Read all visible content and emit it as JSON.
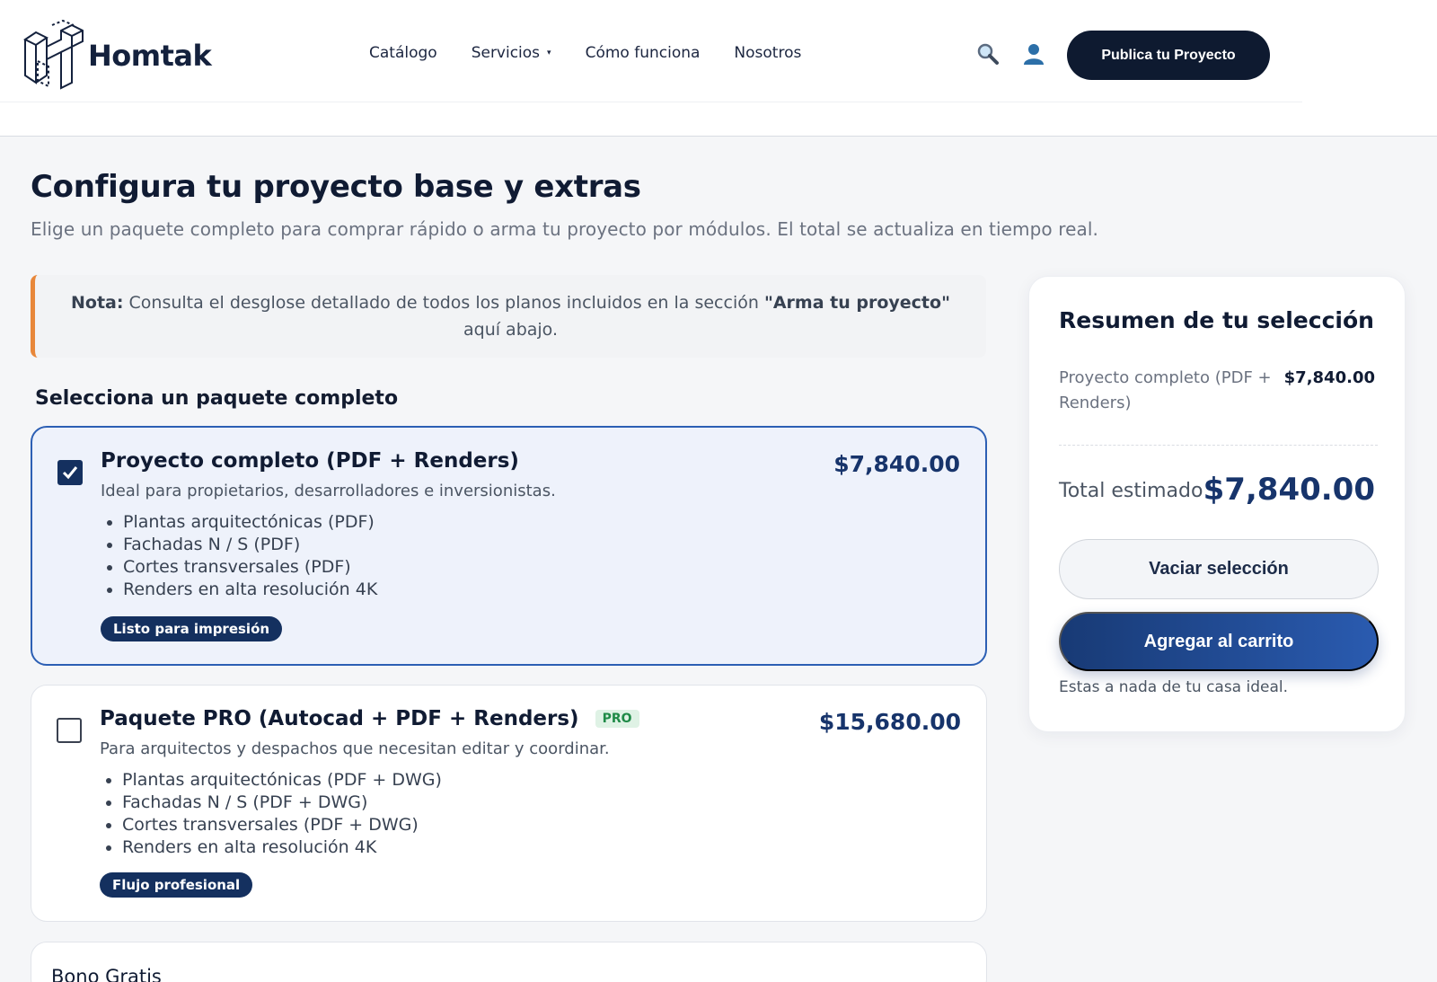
{
  "header": {
    "brand": "Homtak",
    "nav": [
      {
        "label": "Catálogo"
      },
      {
        "label": "Servicios",
        "caret": "▾"
      },
      {
        "label": "Cómo funciona"
      },
      {
        "label": "Nosotros"
      }
    ],
    "search_icon": "search-icon",
    "user_icon": "user-icon",
    "cta_label": "Publica tu Proyecto"
  },
  "main": {
    "title": "Configura tu proyecto base y extras",
    "subtitle": "Elige un paquete completo para comprar rápido o arma tu proyecto por módulos. El total se actualiza en tiempo real.",
    "note": {
      "prefix": "Nota:",
      "text": " Consulta el desglose detallado de todos los planos incluidos en la sección ",
      "highlight": "\"Arma tu proyecto\"",
      "suffix": "aquí abajo."
    },
    "section_title": "Selecciona un paquete completo",
    "packages": [
      {
        "name": "Proyecto completo (PDF + Renders)",
        "price": "$7,840.00",
        "description": "Ideal para propietarios, desarrolladores e inversionistas.",
        "features": [
          "Plantas arquitectónicas (PDF)",
          "Fachadas N / S (PDF)",
          "Cortes transversales (PDF)",
          "Renders en alta resolución 4K"
        ],
        "tag": "Listo para impresión",
        "selected": true
      },
      {
        "name": "Paquete PRO (Autocad + PDF + Renders)",
        "badge": "PRO",
        "price": "$15,680.00",
        "description": "Para arquitectos y despachos que necesitan editar y coordinar.",
        "features": [
          "Plantas arquitectónicas (PDF + DWG)",
          "Fachadas N / S (PDF + DWG)",
          "Cortes transversales (PDF + DWG)",
          "Renders en alta resolución 4K"
        ],
        "tag": "Flujo profesional",
        "selected": false
      }
    ],
    "bono_label": "Bono Gratis"
  },
  "summary": {
    "title": "Resumen de tu selección",
    "line_item_name": "Proyecto completo (PDF + Renders)",
    "line_item_price": "$7,840.00",
    "total_label": "Total estimado",
    "total_value": "$7,840.00",
    "clear_label": "Vaciar selección",
    "cart_label": "Agregar al carrito",
    "footnote": "Estas a nada de tu casa ideal."
  },
  "colors": {
    "brand_dark": "#0e1a30",
    "accent_blue": "#2c5fb4",
    "note_orange": "#e8873a",
    "pro_green": "#1f8a47"
  }
}
